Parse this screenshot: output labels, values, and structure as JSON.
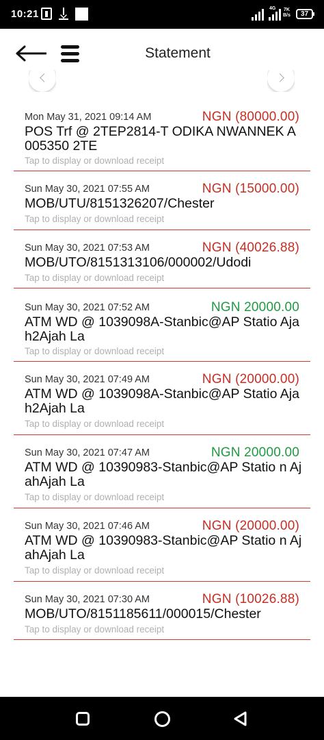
{
  "status_bar": {
    "time": "10:21",
    "network_label": "4G",
    "speed_value": "7K",
    "speed_unit": "B/s",
    "battery": "37",
    "icons": [
      "payment-icon",
      "download-icon",
      "notification-square-icon",
      "signal-icon",
      "signal-icon",
      "battery-icon"
    ]
  },
  "header": {
    "title": "Statement",
    "back_icon": "arrow-left-icon",
    "menu_icon": "hamburger-menu-icon"
  },
  "colors": {
    "debit": "#c62f24",
    "credit": "#1f9a40",
    "divider": "#d13b2f"
  },
  "transactions": [
    {
      "date": "Mon May 31, 2021 09:14 AM",
      "amount": "NGN (80000.00)",
      "type": "debit",
      "description": "POS Trf @ 2TEP2814-T ODIKA NWANNEK A 005350 2TE",
      "hint": "Tap to display or download receipt"
    },
    {
      "date": "Sun May 30, 2021 07:55 AM",
      "amount": "NGN (15000.00)",
      "type": "debit",
      "description": "MOB/UTU/8151326207/Chester",
      "hint": "Tap to display or download receipt"
    },
    {
      "date": "Sun May 30, 2021 07:53 AM",
      "amount": "NGN (40026.88)",
      "type": "debit",
      "description": "MOB/UTO/8151313106/000002/Udodi",
      "hint": "Tap to display or download receipt"
    },
    {
      "date": "Sun May 30, 2021 07:52 AM",
      "amount": "NGN 20000.00",
      "type": "credit",
      "description": "ATM WD @ 1039098A-Stanbic@AP Statio Ajah2Ajah La",
      "hint": "Tap to display or download receipt"
    },
    {
      "date": "Sun May 30, 2021 07:49 AM",
      "amount": "NGN (20000.00)",
      "type": "debit",
      "description": "ATM WD @ 1039098A-Stanbic@AP Statio Ajah2Ajah La",
      "hint": "Tap to display or download receipt"
    },
    {
      "date": "Sun May 30, 2021 07:47 AM",
      "amount": "NGN 20000.00",
      "type": "credit",
      "description": "ATM WD @ 10390983-Stanbic@AP Statio n AjahAjah La",
      "hint": "Tap to display or download receipt"
    },
    {
      "date": "Sun May 30, 2021 07:46 AM",
      "amount": "NGN (20000.00)",
      "type": "debit",
      "description": "ATM WD @ 10390983-Stanbic@AP Statio n AjahAjah La",
      "hint": "Tap to display or download receipt"
    },
    {
      "date": "Sun May 30, 2021 07:30 AM",
      "amount": "NGN (10026.88)",
      "type": "debit",
      "description": "MOB/UTO/8151185611/000015/Chester",
      "hint": "Tap to display or download receipt"
    }
  ],
  "nav_bar": {
    "icons": [
      "recents-square-icon",
      "home-circle-icon",
      "back-triangle-icon"
    ]
  }
}
